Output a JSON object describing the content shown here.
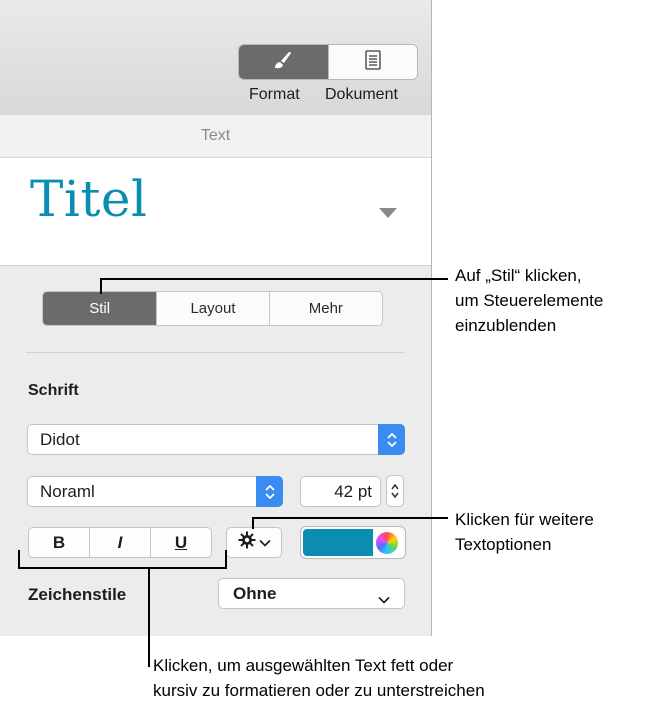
{
  "toolbar": {
    "format_label": "Format",
    "document_label": "Dokument",
    "format_icon": "paintbrush-icon",
    "document_icon": "document-icon"
  },
  "section": {
    "title": "Text"
  },
  "paragraph_style": {
    "name": "Titel",
    "color": "#0a8db1"
  },
  "tabs": [
    {
      "label": "Stil",
      "active": true
    },
    {
      "label": "Layout",
      "active": false
    },
    {
      "label": "Mehr",
      "active": false
    }
  ],
  "font": {
    "heading": "Schrift",
    "family": "Didot",
    "typeface": "Noraml",
    "size": "42 pt"
  },
  "format_buttons": {
    "bold": "B",
    "italic": "I",
    "underline": "U"
  },
  "text_color": "#0a8db1",
  "character_styles": {
    "label": "Zeichenstile",
    "value": "Ohne"
  },
  "callouts": {
    "stil": "Auf „Stil“ klicken,\num Steuerelemente\neinzublenden",
    "options": "Klicken für weitere\nTextoptionen",
    "biu": "Klicken, um ausgewählten Text fett oder\nkursiv zu formatieren oder zu unterstreichen"
  }
}
